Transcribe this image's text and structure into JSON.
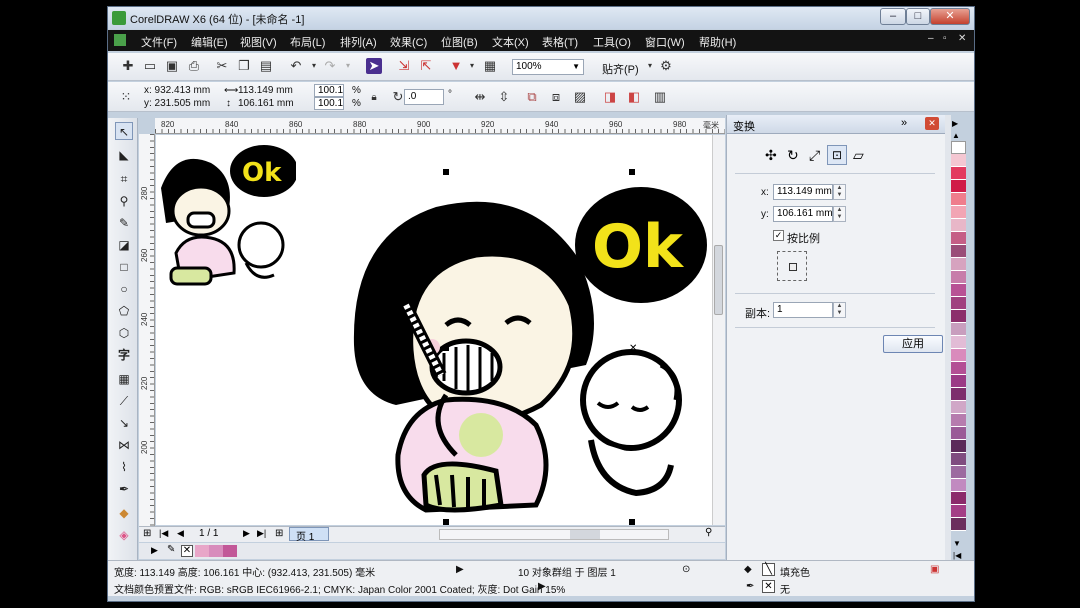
{
  "window": {
    "title": "CorelDRAW X6 (64 位) - [未命名 -1]",
    "minimize": "–",
    "maximize": "□",
    "close": "✕"
  },
  "menu": [
    "文件(F)",
    "编辑(E)",
    "视图(V)",
    "布局(L)",
    "排列(A)",
    "效果(C)",
    "位图(B)",
    "文本(X)",
    "表格(T)",
    "工具(O)",
    "窗口(W)",
    "帮助(H)"
  ],
  "toolbar": {
    "zoom": "100%",
    "snap_label": "贴齐(P)"
  },
  "property_bar": {
    "x": "x: 932.413 mm",
    "y": "y: 231.505 mm",
    "width": "113.149 mm",
    "height": "106.161 mm",
    "scale_x": "100.1",
    "scale_y": "100.1",
    "percent": "%",
    "rotation": ".0",
    "degree": "°"
  },
  "ruler_top": [
    "820",
    "840",
    "860",
    "880",
    "900",
    "920",
    "940",
    "960",
    "980",
    "毫米"
  ],
  "ruler_left": [
    "280",
    "260",
    "240",
    "220",
    "200"
  ],
  "canvas": {
    "ok_text": "Ok"
  },
  "page_nav": {
    "page_counter": "1 / 1",
    "page_tab": "页 1"
  },
  "docker": {
    "title": "变换",
    "x_label": "x:",
    "x_value": "113.149 mm",
    "y_label": "y:",
    "y_value": "106.161 mm",
    "proportional_label": "按比例",
    "copies_label": "副本:",
    "copies_value": "1",
    "apply_label": "应用"
  },
  "status": {
    "dimensions": "宽度: 113.149  高度: 106.161  中心: (932.413, 231.505)  毫米",
    "selection": "10 对象群组 于 图层 1",
    "color_profile": "文档颜色预置文件: RGB: sRGB IEC61966-2.1; CMYK: Japan Color 2001 Coated; 灰度: Dot Gain 15%",
    "fill_label": "填充色",
    "outline_label": "无"
  },
  "colors": {
    "accent": "#e8487a",
    "ok_yellow": "#f2e21a",
    "skin": "#faf4e4",
    "dress_pink": "#f8dcec",
    "stripe_green": "#d8e8a0"
  },
  "palette": [
    "#ffffff",
    "#f4c7d2",
    "#e33a5f",
    "#d01a47",
    "#ef7d8c",
    "#f2a5b4",
    "#e8b7c8",
    "#c55e86",
    "#9a4d78",
    "#d6a3bf",
    "#c77daa",
    "#b85295",
    "#a0407f",
    "#8c2f6c",
    "#c89ebe",
    "#e2bcd6",
    "#d98bbc",
    "#b34f95",
    "#9b3a86",
    "#7d2e6d",
    "#d0a7c7",
    "#b67cae",
    "#9a5b97",
    "#5b2a5a",
    "#7f4c80",
    "#9c6aa0",
    "#c18ac0",
    "#8b2a6b",
    "#a43d86",
    "#6b2d5d"
  ]
}
